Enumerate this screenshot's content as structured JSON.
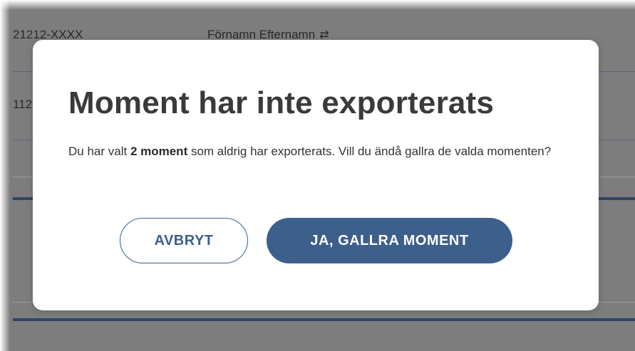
{
  "background_table": {
    "rows": [
      {
        "id": "21212-XXXX",
        "name": "Förnamn Efternamn",
        "swap_icon": "swap-arrows-icon"
      },
      {
        "id": "112"
      }
    ]
  },
  "dialog": {
    "title": "Moment har inte exporterats",
    "body_before": "Du har valt ",
    "body_bold": "2 moment",
    "body_after": " som aldrig har exporterats. Vill du ändå gallra de valda momenten?",
    "cancel_label": "AVBRYT",
    "confirm_label": "JA, GALLRA MOMENT"
  },
  "colors": {
    "primary": "#3d5f8c",
    "overlay": "#7d7d7d",
    "title_text": "#3a3a3a"
  }
}
